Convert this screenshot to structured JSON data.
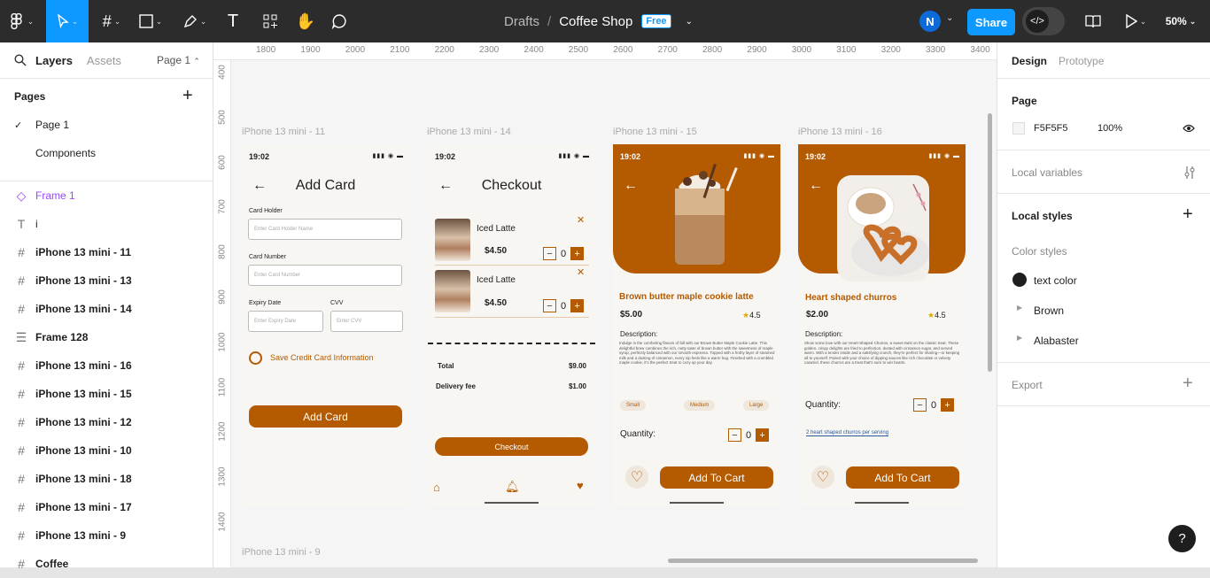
{
  "topbar": {
    "breadcrumb": "Drafts",
    "separator": "/",
    "file_name": "Coffee Shop",
    "plan_badge": "Free",
    "avatar_initial": "N",
    "share_label": "Share",
    "zoom": "50%"
  },
  "left_panel": {
    "tabs": [
      "Layers",
      "Assets"
    ],
    "page_selector": "Page 1",
    "pages_header": "Pages",
    "pages": [
      {
        "label": "Page 1",
        "checked": true
      },
      {
        "label": "Components",
        "checked": false
      }
    ],
    "layers": [
      {
        "label": "Frame 1",
        "icon": "component-icon"
      },
      {
        "label": "i",
        "icon": "text-icon"
      },
      {
        "label": "iPhone 13 mini - 11",
        "icon": "frame-icon"
      },
      {
        "label": "iPhone 13 mini - 13",
        "icon": "frame-icon"
      },
      {
        "label": "iPhone 13 mini - 14",
        "icon": "frame-icon"
      },
      {
        "label": "Frame 128",
        "icon": "auto-layout-icon"
      },
      {
        "label": "iPhone 13 mini - 16",
        "icon": "frame-icon"
      },
      {
        "label": "iPhone 13 mini - 15",
        "icon": "frame-icon"
      },
      {
        "label": "iPhone 13 mini - 12",
        "icon": "frame-icon"
      },
      {
        "label": "iPhone 13 mini - 10",
        "icon": "frame-icon"
      },
      {
        "label": "iPhone 13 mini - 18",
        "icon": "frame-icon"
      },
      {
        "label": "iPhone 13 mini - 17",
        "icon": "frame-icon"
      },
      {
        "label": "iPhone 13 mini - 9",
        "icon": "frame-icon"
      },
      {
        "label": "Coffee",
        "icon": "frame-icon"
      }
    ]
  },
  "right_panel": {
    "tabs": [
      "Design",
      "Prototype"
    ],
    "page_section": "Page",
    "page_color": "F5F5F5",
    "page_opacity": "100%",
    "local_variables": "Local variables",
    "local_styles": "Local styles",
    "color_styles_header": "Color styles",
    "color_styles": [
      {
        "label": "text color",
        "color": "#1e1e1e"
      },
      {
        "label": "Brown",
        "color": "#b45a00"
      },
      {
        "label": "Alabaster",
        "color": "#f8f6f2"
      }
    ],
    "export": "Export"
  },
  "rulers": {
    "top": [
      "1800",
      "1900",
      "2000",
      "2100",
      "2200",
      "2300",
      "2400",
      "2500",
      "2600",
      "2700",
      "2800",
      "2900",
      "3000",
      "3100",
      "3200",
      "3300",
      "3400"
    ],
    "left": [
      "400",
      "500",
      "600",
      "700",
      "800",
      "900",
      "1000",
      "1100",
      "1200",
      "1300",
      "1400"
    ]
  },
  "frames": {
    "labels": [
      "iPhone 13 mini - 11",
      "iPhone 13 mini - 14",
      "iPhone 13 mini - 15",
      "iPhone 13 mini - 16",
      "iPhone 13 mini - 9"
    ],
    "time": "19:02",
    "add_card": {
      "title": "Add Card",
      "card_holder_label": "Card Holder",
      "card_holder_placeholder": "Enter Card Holder Name",
      "card_number_label": "Card Number",
      "card_number_placeholder": "Enter Card Number",
      "expiry_label": "Expiry Date",
      "expiry_placeholder": "Enter Expiry Date",
      "cvv_label": "CVV",
      "cvv_placeholder": "Enter CVV",
      "save_label": "Save Credit Card Information",
      "button": "Add Card"
    },
    "checkout": {
      "title": "Checkout",
      "items": [
        {
          "name": "Iced Latte",
          "price": "$4.50",
          "qty": "0"
        },
        {
          "name": "Iced Latte",
          "price": "$4.50",
          "qty": "0"
        }
      ],
      "total_label": "Total",
      "total_value": "$9.00",
      "delivery_label": "Delivery fee",
      "delivery_value": "$1.00",
      "button": "Checkout"
    },
    "latte": {
      "name": "Brown butter maple cookie latte",
      "price": "$5.00",
      "rating": "4.5",
      "description_label": "Description:",
      "description": "Indulge in the comforting flavors of fall with our Brown Butter Maple Cookie Latte. This delightful brew combines the rich, nutty taste of brown butter with the sweetness of maple syrup, perfectly balanced with our smooth espresso. Topped with a frothy layer of steamed milk and a dusting of cinnamon, every sip feels like a warm hug. Finished with a crumbled maple cookie, it's the perfect treat to cozy up your day.",
      "sizes": [
        "Small",
        "Medium",
        "Large"
      ],
      "quantity_label": "Quantity:",
      "qty": "0",
      "button": "Add To Cart"
    },
    "churros": {
      "name": "Heart shaped churros",
      "price": "$2.00",
      "rating": "4.5",
      "description_label": "Description:",
      "description": "Show some love with our Heart-Shaped Churros, a sweet twist on the classic treat. These golden, crispy delights are fried to perfection, dusted with cinnamon sugar, and served warm. With a tender inside and a satisfying crunch, they're perfect for sharing—or keeping all to yourself. Paired with your choice of dipping sauces like rich chocolate or velvety caramel, these churros are a treat that's sure to win hearts.",
      "quantity_label": "Quantity:",
      "qty": "0",
      "serving": "2 heart shaped churros per serving",
      "button": "Add To Cart"
    }
  },
  "help": "?"
}
